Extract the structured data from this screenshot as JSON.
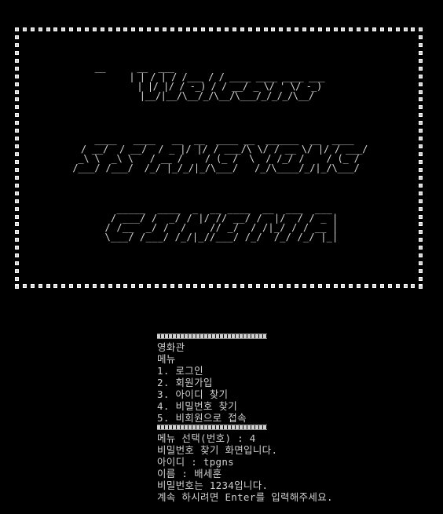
{
  "ascii_art": {
    "welcome": "   __      __  ___                                    \n   | | / | / /___ / / ____ ____ ____ ___ \n   | |/ |/ / -_) / / __/ _ \\/ ' \\/ -_)\n   |__/|__/\\__/_/\\__/\\___/_/_/_/\\__/ ",
    "sangyong": "  ____   ____   __  __  ____ __  ______  __  ____ \n / __/  / __/  / _ |/ |/ / ___/\\ \\/ / __ \\/ |/ / ___/\n_\\ \\  _\\ \\   / __ /    / (_ /  \\  / /_/ /    / (_ / \n/___/ /___/  /_/ |_/_/|_/\\___/   /_/\\____/_/|_/\\___/  ",
    "cinema": "  _____  ____  _  __ ____  __  ___  ___ \n / ___/ /  _/ / |/ // __/ /  |/  / / _ |\n/ /__  _/ /  /    // _/  / /|_/ / / __ |\n\\___/ /___/ /_/|_//___/ /_/  /_/ /_/ |_|"
  },
  "console": {
    "header_title": "영화관",
    "menu_label": "메뉴",
    "menu_items": [
      "1. 로그인",
      "2. 회원가입",
      "3. 아이디 찾기",
      "4. 비밀번호 찾기",
      "5. 비회원으로 접속"
    ],
    "prompt_line": "메뉴 선택(번호) : 4",
    "screen_line": "비밀번호 찾기 화면입니다.",
    "id_line": "아이디 : tpgns",
    "name_line": "이름 : 배세훈",
    "password_line": "비밀번호는 1234입니다.",
    "continue_line": "계속 하시려면 Enter를 입력해주세요."
  }
}
